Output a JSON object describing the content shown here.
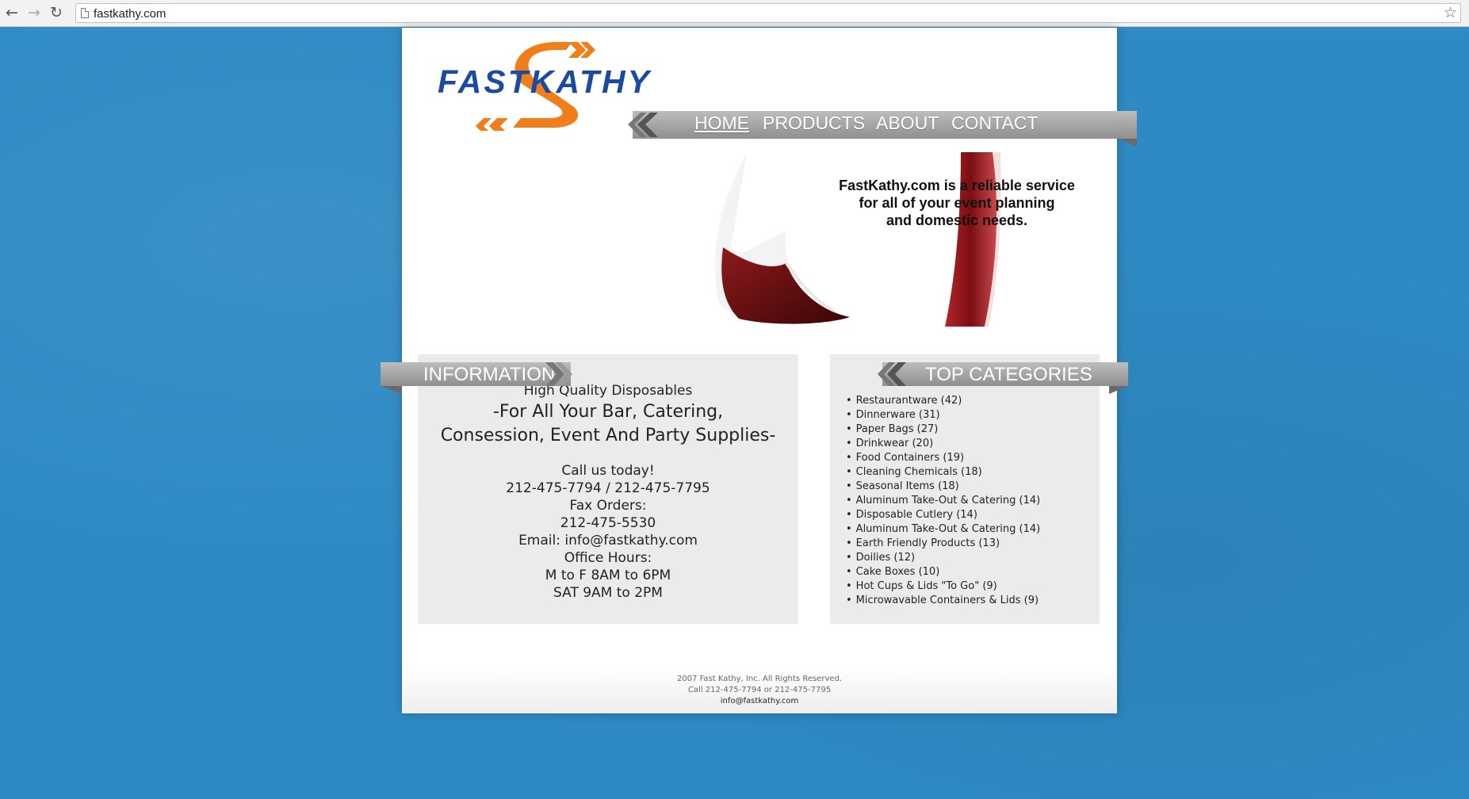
{
  "browser": {
    "url": "fastkathy.com",
    "icons": [
      "back-arrow-icon",
      "forward-arrow-icon",
      "reload-icon",
      "page-icon",
      "star-icon"
    ]
  },
  "colors": {
    "background": "#2f8ac4",
    "logo_blue": "#1b4aa3",
    "logo_orange": "#f07f1b",
    "ribbon_gray": "#a8a8a8",
    "panel_gray": "#ebebeb"
  },
  "logo": {
    "text": "FASTKATHY"
  },
  "nav": {
    "items": [
      {
        "label": "HOME",
        "active": true
      },
      {
        "label": "PRODUCTS"
      },
      {
        "label": "ABOUT"
      },
      {
        "label": "CONTACT"
      }
    ]
  },
  "hero": {
    "lines": [
      "FastKathy.com is a reliable service",
      "for all of your event planning",
      "and domestic needs."
    ]
  },
  "info": {
    "title": "INFORMATION",
    "tagline": "High Quality Disposables",
    "headline": [
      "-For All Your Bar, Catering,",
      "Consession, Event And Party Supplies-"
    ],
    "contact": [
      "Call us today!",
      "212-475-7794 / 212-475-7795",
      "Fax Orders:",
      "212-475-5530",
      "Email: info@fastkathy.com",
      "Office Hours:",
      "M to F 8AM to 6PM",
      "SAT 9AM to 2PM"
    ]
  },
  "categories": {
    "title": "TOP CATEGORIES",
    "items": [
      "Restaurantware (42)",
      "Dinnerware (31)",
      "Paper Bags (27)",
      "Drinkwear (20)",
      "Food Containers (19)",
      "Cleaning Chemicals (18)",
      "Seasonal Items (18)",
      "Aluminum Take-Out & Catering (14)",
      "Disposable Cutlery (14)",
      "Aluminum Take-Out & Catering (14)",
      "Earth Friendly Products (13)",
      "Doilies (12)",
      "Cake Boxes (10)",
      "Hot Cups & Lids \"To Go\" (9)",
      "Microwavable Containers & Lids (9)"
    ]
  },
  "footer": {
    "copyright": "2007 Fast Kathy, Inc. All Rights Reserved.",
    "phone": "Call 212-475-7794 or 212-475-7795",
    "email": "info@fastkathy.com"
  }
}
